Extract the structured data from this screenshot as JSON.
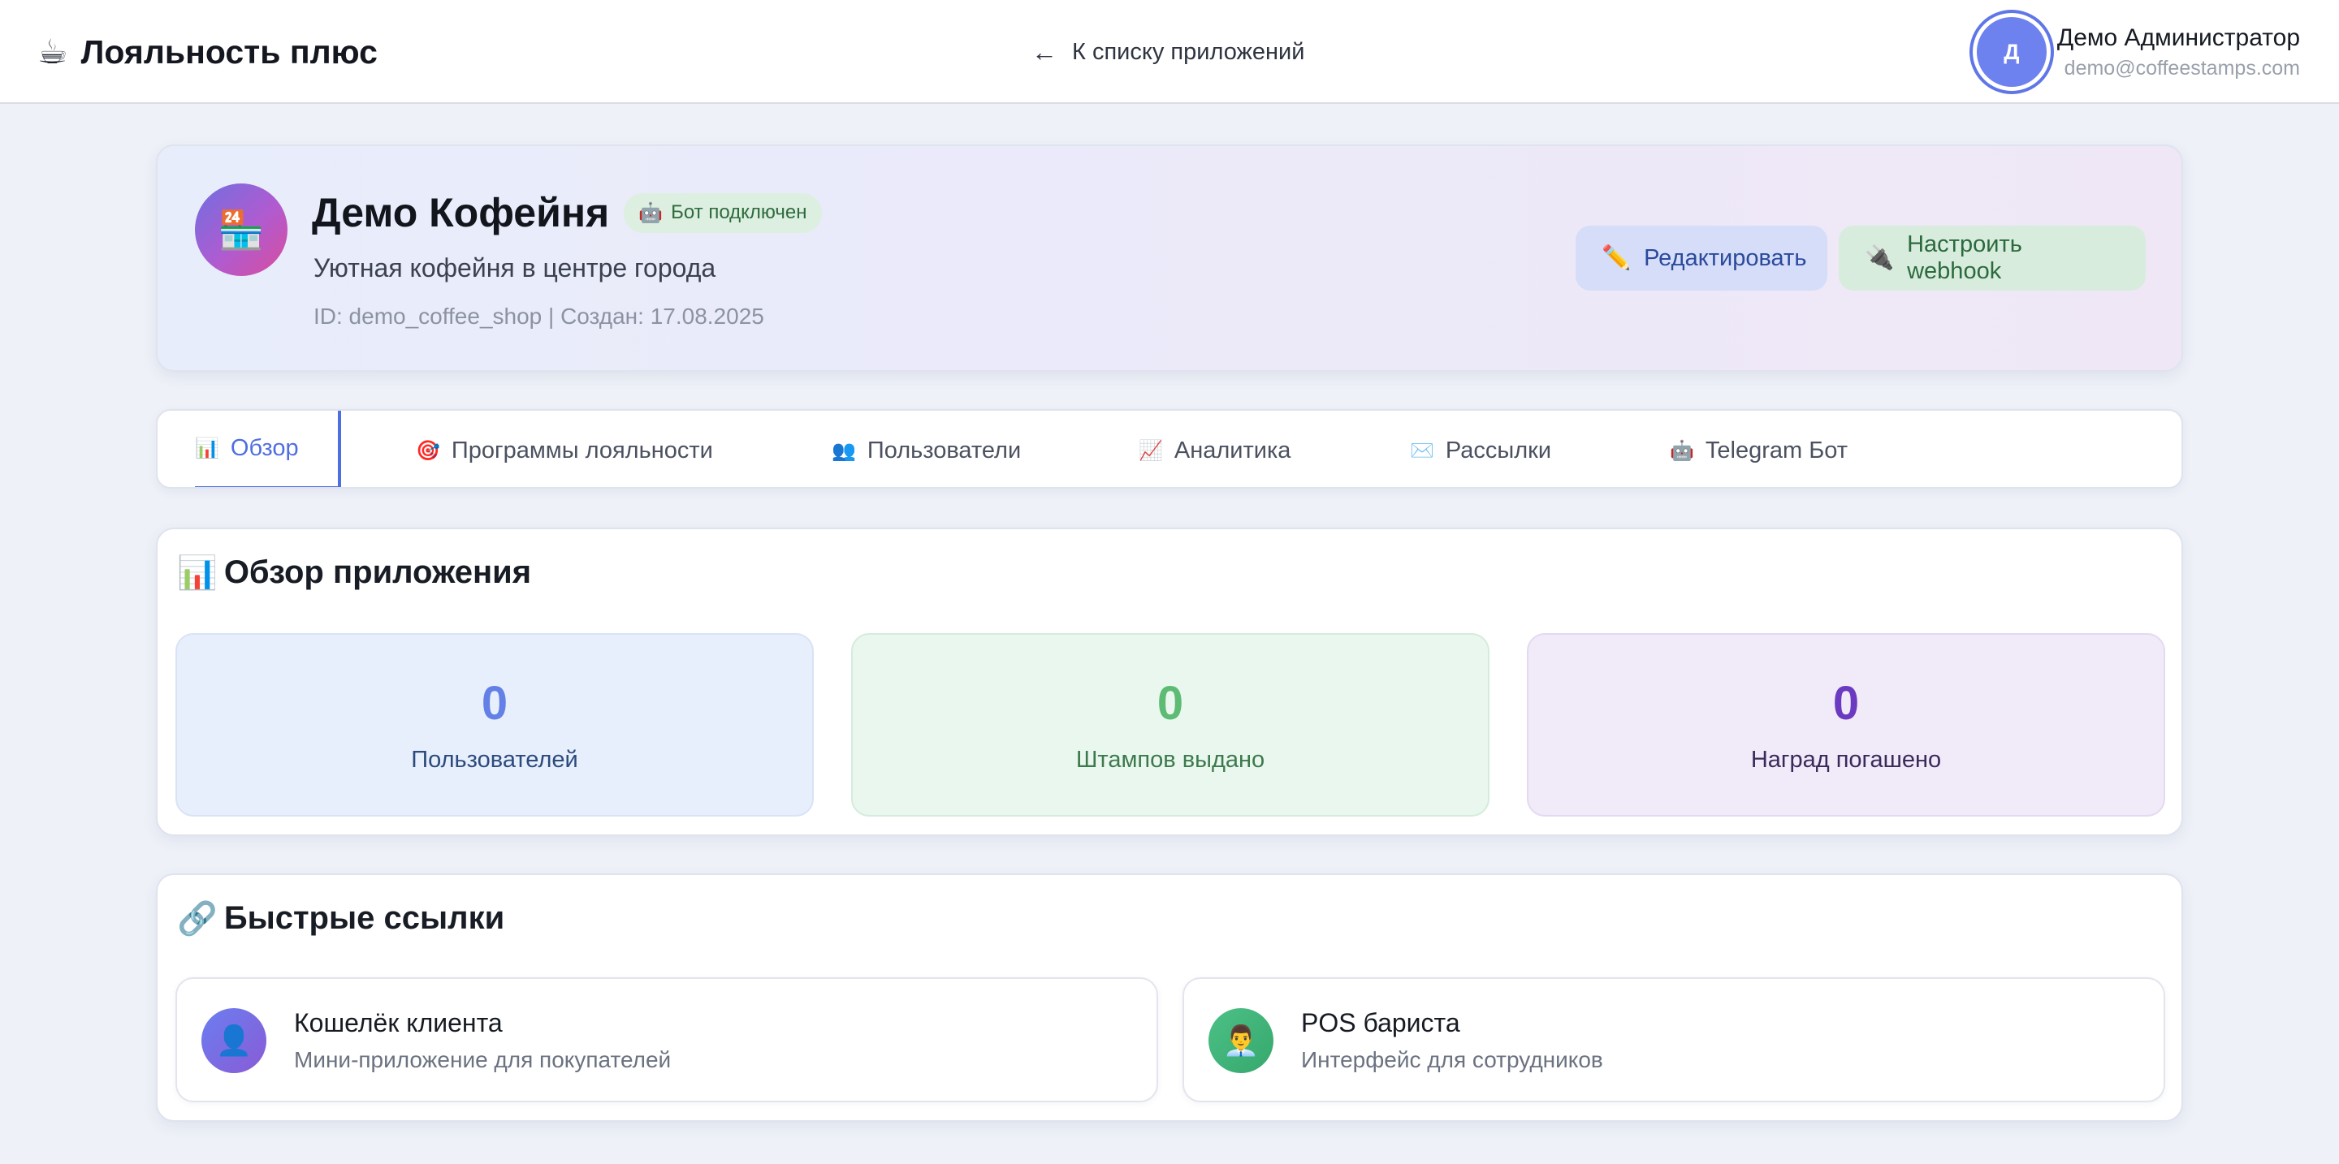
{
  "header": {
    "brand_icon": "coffee-icon",
    "brand_glyph": "☕",
    "brand_name": "Лояльность плюс",
    "back_arrow": "←",
    "back_label": "К списку приложений",
    "user_initial": "Д",
    "user_name": "Демо Администратор",
    "user_email": "demo@coffeestamps.com"
  },
  "app": {
    "icon_glyph": "🏪",
    "title": "Демо Кофейня",
    "badge_icon": "🤖",
    "badge_label": "Бот подключен",
    "description": "Уютная кофейня в центре города",
    "meta": "ID: demo_coffee_shop | Создан: 17.08.2025",
    "edit_icon": "✏️",
    "edit_label": "Редактировать",
    "webhook_icon": "🔌",
    "webhook_label": "Настроить webhook"
  },
  "tabs": [
    {
      "icon": "📊",
      "label": "Обзор",
      "active": true
    },
    {
      "icon": "🎯",
      "label": "Программы лояльности"
    },
    {
      "icon": "👥",
      "label": "Пользователи"
    },
    {
      "icon": "📈",
      "label": "Аналитика"
    },
    {
      "icon": "✉️",
      "label": "Рассылки"
    },
    {
      "icon": "🤖",
      "label": "Telegram Бот"
    }
  ],
  "overview": {
    "title_icon": "📊",
    "title": "Обзор приложения",
    "stats": [
      {
        "value": "0",
        "label": "Пользователей"
      },
      {
        "value": "0",
        "label": "Штампов выдано"
      },
      {
        "value": "0",
        "label": "Наград погашено"
      }
    ]
  },
  "quick_links": {
    "title_icon": "🔗",
    "title": "Быстрые ссылки",
    "items": [
      {
        "icon": "👤",
        "title": "Кошелёк клиента",
        "subtitle": "Мини-приложение для покупателей"
      },
      {
        "icon": "👨‍💼",
        "title": "POS бариста",
        "subtitle": "Интерфейс для сотрудников"
      }
    ]
  },
  "colors": {
    "accent": "#4f6ee0",
    "stat_users": "#6380e6",
    "stat_stamps": "#5dbb74",
    "stat_rewards": "#6a3ac0"
  }
}
